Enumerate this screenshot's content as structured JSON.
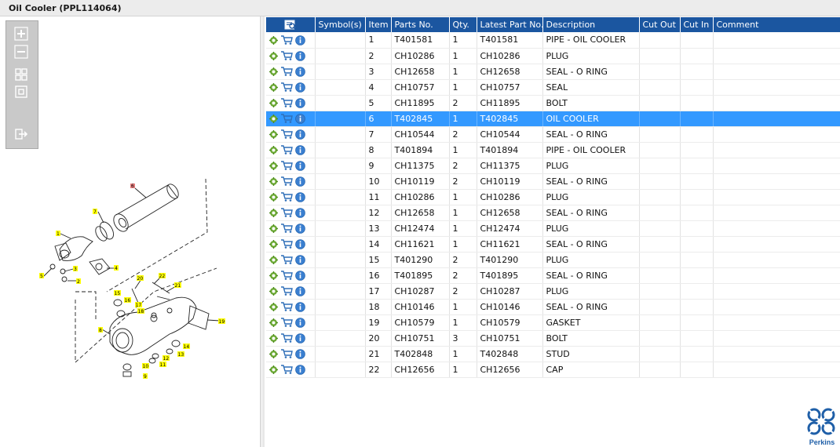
{
  "window": {
    "title": "Oil Cooler (PPL114064)"
  },
  "zoom_toolbar": {
    "buttons": [
      {
        "name": "zoom-in-button",
        "icon": "zoom-in-icon"
      },
      {
        "name": "zoom-out-button",
        "icon": "zoom-out-icon"
      },
      {
        "name": "fit-all-button",
        "icon": "fit-all-icon"
      },
      {
        "name": "actual-size-button",
        "icon": "actual-size-icon"
      },
      {
        "name": "export-button",
        "icon": "export-arrow-icon"
      }
    ]
  },
  "diagram": {
    "callouts": [
      "6",
      "7",
      "1",
      "3",
      "5",
      "2",
      "4",
      "20",
      "22",
      "21",
      "16",
      "15",
      "17",
      "18",
      "19",
      "8",
      "14",
      "13",
      "12",
      "10",
      "11",
      "9"
    ],
    "highlight_color": "#ffff00",
    "selected_color": "#e88080"
  },
  "table": {
    "header_color": "#1b56a0",
    "selected_color": "#3399ff",
    "columns": [
      "",
      "Symbol(s)",
      "Item",
      "Parts No.",
      "Qty.",
      "Latest Part No.",
      "Description",
      "Cut Out",
      "Cut In",
      "Comment"
    ],
    "header_icon": "search-list-icon",
    "row_icons": [
      "gear-icon",
      "shopping-cart-icon",
      "info-icon"
    ],
    "selected_item": "6",
    "rows": [
      {
        "item": "1",
        "part_no": "T401581",
        "qty": "1",
        "latest": "T401581",
        "desc": "PIPE - OIL COOLER"
      },
      {
        "item": "2",
        "part_no": "CH10286",
        "qty": "1",
        "latest": "CH10286",
        "desc": "PLUG"
      },
      {
        "item": "3",
        "part_no": "CH12658",
        "qty": "1",
        "latest": "CH12658",
        "desc": "SEAL - O RING"
      },
      {
        "item": "4",
        "part_no": "CH10757",
        "qty": "1",
        "latest": "CH10757",
        "desc": "SEAL"
      },
      {
        "item": "5",
        "part_no": "CH11895",
        "qty": "2",
        "latest": "CH11895",
        "desc": "BOLT"
      },
      {
        "item": "6",
        "part_no": "T402845",
        "qty": "1",
        "latest": "T402845",
        "desc": "OIL COOLER"
      },
      {
        "item": "7",
        "part_no": "CH10544",
        "qty": "2",
        "latest": "CH10544",
        "desc": "SEAL - O RING"
      },
      {
        "item": "8",
        "part_no": "T401894",
        "qty": "1",
        "latest": "T401894",
        "desc": "PIPE - OIL COOLER"
      },
      {
        "item": "9",
        "part_no": "CH11375",
        "qty": "2",
        "latest": "CH11375",
        "desc": "PLUG"
      },
      {
        "item": "10",
        "part_no": "CH10119",
        "qty": "2",
        "latest": "CH10119",
        "desc": "SEAL - O RING"
      },
      {
        "item": "11",
        "part_no": "CH10286",
        "qty": "1",
        "latest": "CH10286",
        "desc": "PLUG"
      },
      {
        "item": "12",
        "part_no": "CH12658",
        "qty": "1",
        "latest": "CH12658",
        "desc": "SEAL - O RING"
      },
      {
        "item": "13",
        "part_no": "CH12474",
        "qty": "1",
        "latest": "CH12474",
        "desc": "PLUG"
      },
      {
        "item": "14",
        "part_no": "CH11621",
        "qty": "1",
        "latest": "CH11621",
        "desc": "SEAL - O RING"
      },
      {
        "item": "15",
        "part_no": "T401290",
        "qty": "2",
        "latest": "T401290",
        "desc": "PLUG"
      },
      {
        "item": "16",
        "part_no": "T401895",
        "qty": "2",
        "latest": "T401895",
        "desc": "SEAL - O RING"
      },
      {
        "item": "17",
        "part_no": "CH10287",
        "qty": "2",
        "latest": "CH10287",
        "desc": "PLUG"
      },
      {
        "item": "18",
        "part_no": "CH10146",
        "qty": "1",
        "latest": "CH10146",
        "desc": "SEAL - O RING"
      },
      {
        "item": "19",
        "part_no": "CH10579",
        "qty": "1",
        "latest": "CH10579",
        "desc": "GASKET"
      },
      {
        "item": "20",
        "part_no": "CH10751",
        "qty": "3",
        "latest": "CH10751",
        "desc": "BOLT"
      },
      {
        "item": "21",
        "part_no": "T402848",
        "qty": "1",
        "latest": "T402848",
        "desc": "STUD"
      },
      {
        "item": "22",
        "part_no": "CH12656",
        "qty": "1",
        "latest": "CH12656",
        "desc": "CAP"
      }
    ]
  },
  "logo": {
    "text": "Perkins",
    "color": "#1f5fa8"
  }
}
